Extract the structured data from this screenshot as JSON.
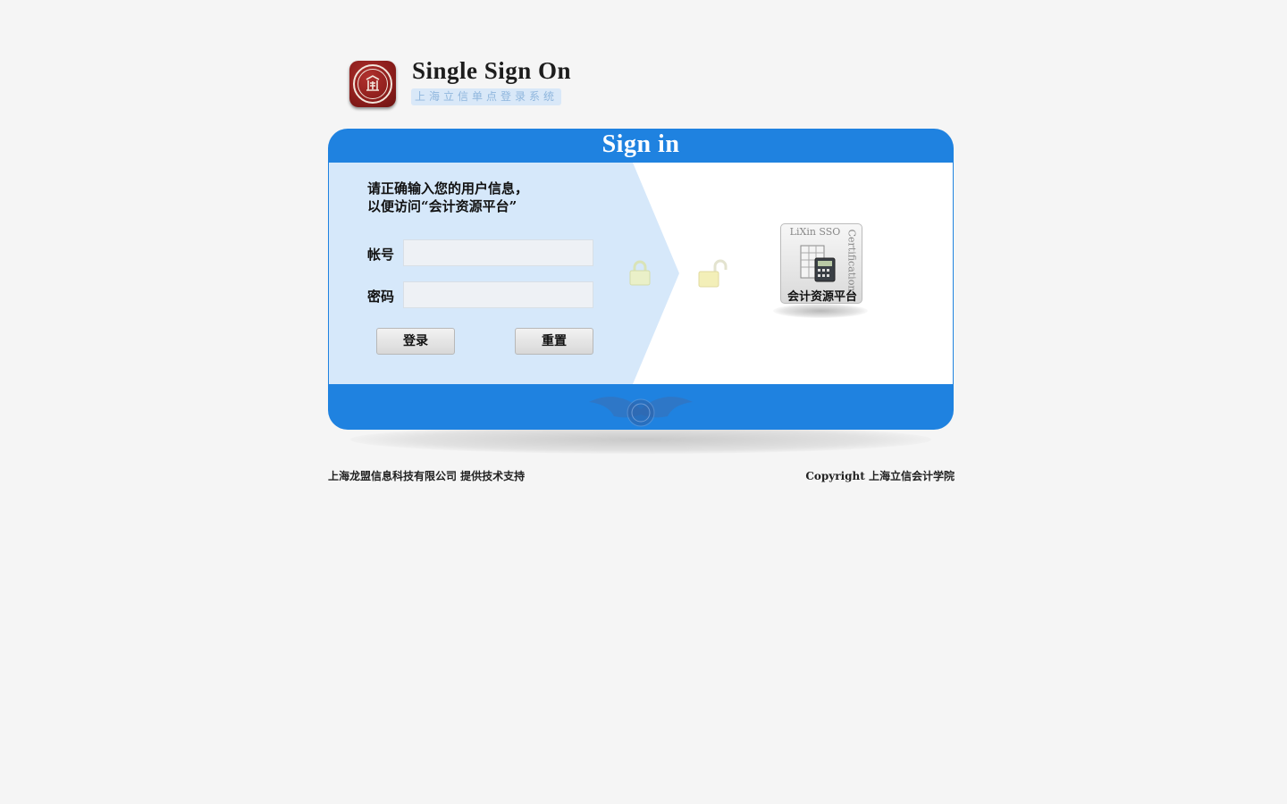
{
  "header": {
    "title": "Single Sign On",
    "subtitle": "上海立信单点登录系统"
  },
  "panel": {
    "title": "Sign in",
    "intro_line1": "请正确输入您的用户信息，",
    "intro_line2": "以便访问“会计资源平台”",
    "account_label": "帐号",
    "account_value": "",
    "account_placeholder": "",
    "password_label": "密码",
    "password_value": "",
    "password_placeholder": "",
    "login_button": "登录",
    "reset_button": "重置"
  },
  "certificate": {
    "top_text": "LiXin SSO",
    "side_text": "Certification",
    "name": "会计资源平台"
  },
  "icons": {
    "logo": "university-seal-icon",
    "lock_closed": "lock-closed-icon",
    "lock_open": "lock-open-icon",
    "calculator": "calculator-icon",
    "emblem": "winged-emblem-icon"
  },
  "footer": {
    "left": "上海龙盟信息科技有限公司 提供技术支持",
    "right": "Copyright  上海立信会计学院"
  },
  "colors": {
    "background": "#f5f5f5",
    "panel_blue": "#1f82e0",
    "form_area": "#d6e8fa",
    "seal_red": "#8b1d1b"
  }
}
